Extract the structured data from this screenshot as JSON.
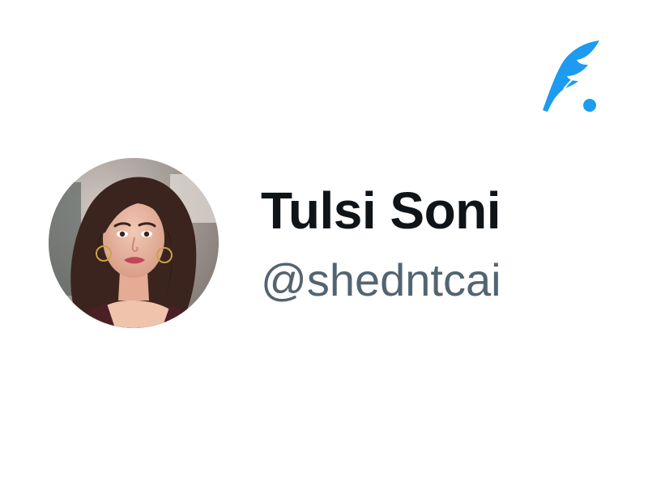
{
  "profile": {
    "display_name": "Tulsi Soni",
    "handle": "@shedntcai"
  },
  "icons": {
    "app_logo": "feather-quill-logo",
    "avatar": "profile-photo"
  },
  "colors": {
    "brand": "#1d9bf0",
    "name_text": "#0f1419",
    "handle_text": "#536471",
    "background": "#ffffff"
  }
}
